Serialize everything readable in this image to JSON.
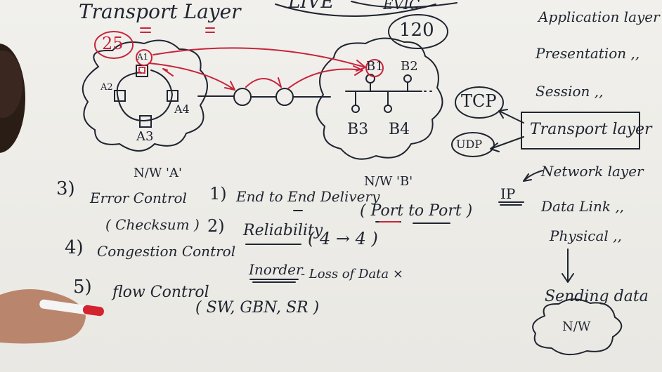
{
  "title": "Transport Layer",
  "top_labels": {
    "live": "LIVE",
    "evic": "EVIC"
  },
  "network_a": {
    "count": "25",
    "hosts": [
      "A1",
      "A2",
      "A3",
      "A4"
    ],
    "label": "N/W 'A'"
  },
  "network_b": {
    "count": "120",
    "hosts": [
      "B1",
      "B2",
      "B3",
      "B4"
    ],
    "label": "N/W 'B'"
  },
  "routers": [
    "×",
    "×"
  ],
  "osi_layers": {
    "application": "Application layer",
    "presentation": "Presentation ,,",
    "session": "Session ,,",
    "transport": "Transport layer",
    "network": "Network layer",
    "datalink": "Data Link ,,",
    "physical": "Physical ,,"
  },
  "protocols": {
    "tcp": "TCP",
    "udp": "UDP",
    "ip": "IP"
  },
  "sending": {
    "label": "Sending data",
    "cloud": "N/W"
  },
  "points": {
    "p1_num": "1)",
    "p1_text": "End to End Delivery",
    "p1_paren": "( Port to Port )",
    "p2_num": "2)",
    "p2_text": "Reliability",
    "p2_paren": "( 4 → 4 )",
    "p2_sub": "Inorder",
    "p2_sub2": "- Loss of Data ×",
    "p3_num": "3)",
    "p3_text": "Error Control",
    "p3_paren": "( Checksum )",
    "p4_num": "4)",
    "p4_text": "Congestion Control",
    "p5_num": "5)",
    "p5_text": "flow Control",
    "p5_paren": "( SW, GBN, SR )"
  },
  "colors": {
    "ink": "#1f2430",
    "red_ink": "#c8243a",
    "board": "#eceae6"
  }
}
